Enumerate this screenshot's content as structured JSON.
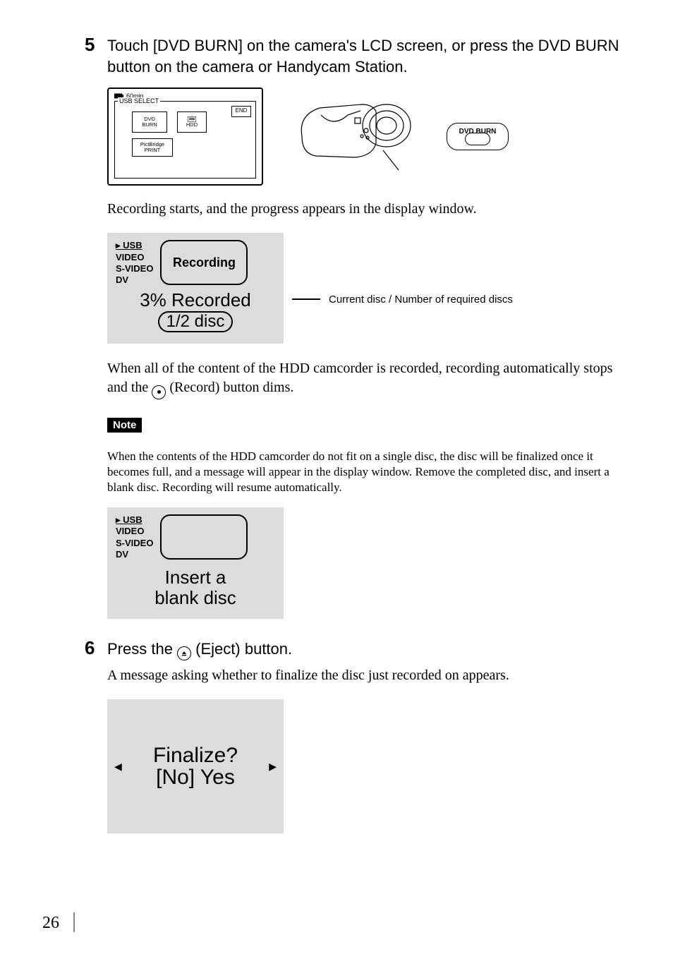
{
  "step5": {
    "number": "5",
    "head": "Touch [DVD BURN] on the camera's LCD screen, or press the DVD BURN button on the camera or Handycam Station.",
    "lcd": {
      "battery_time": "60min",
      "frame_title": "USB SELECT",
      "dvd_burn": "DVD\nBURN",
      "hdd": "HDD",
      "end": "END",
      "pictbridge": "PictBridge\nPRINT"
    },
    "dvdburn_button_label": "DVD BURN",
    "after_lcd_text": "Recording starts, and the progress appears in the display window.",
    "status1": {
      "modes": [
        "USB",
        "VIDEO",
        "S-VIDEO",
        "DV"
      ],
      "bubble": "Recording",
      "progress_line": "3% Recorded",
      "disc_line": "1/2 disc"
    },
    "leader_label": "Current disc / Number of required discs",
    "when_done_a": "When all of the content of the HDD camcorder is recorded, recording automatically stops and the ",
    "when_done_b": " (Record) button dims.",
    "note_label": "Note",
    "note_text": "When the contents of the HDD camcorder do not fit on a single disc, the disc will be finalized once it becomes full, and a message will appear in the display window. Remove the completed disc, and insert a blank disc. Recording will resume automatically.",
    "status2": {
      "modes": [
        "USB",
        "VIDEO",
        "S-VIDEO",
        "DV"
      ],
      "insert_line1": "Insert a",
      "insert_line2": "blank disc"
    }
  },
  "step6": {
    "number": "6",
    "head_a": "Press the ",
    "head_b": " (Eject) button.",
    "body": "A message asking whether to finalize the disc just recorded on appears.",
    "finalize_line1": "Finalize?",
    "finalize_line2": "[No] Yes"
  },
  "page_number": "26"
}
